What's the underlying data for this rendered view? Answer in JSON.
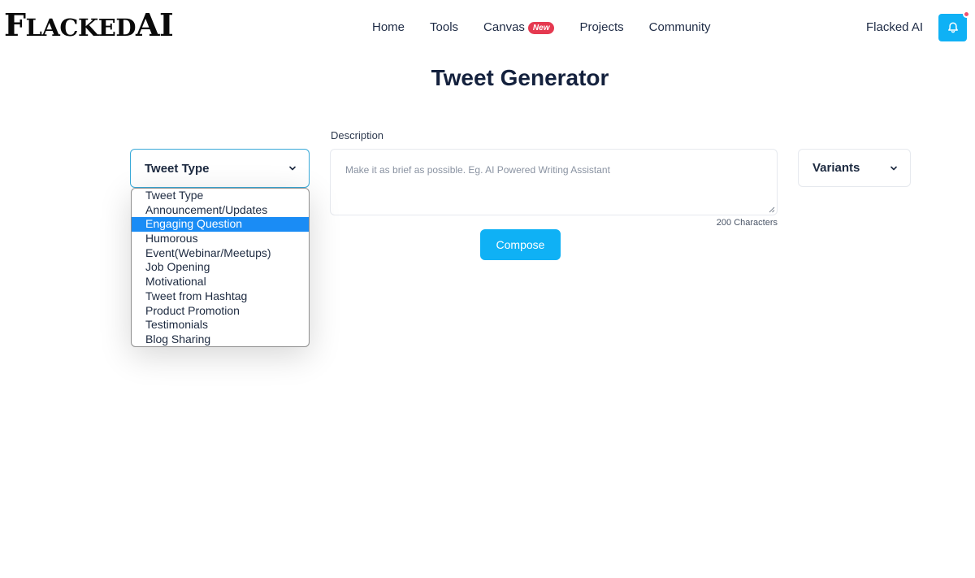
{
  "header": {
    "logo": "FlackedAI",
    "nav": [
      {
        "label": "Home"
      },
      {
        "label": "Tools"
      },
      {
        "label": "Canvas",
        "badge": "New"
      },
      {
        "label": "Projects"
      },
      {
        "label": "Community"
      }
    ],
    "account_name": "Flacked AI",
    "notification_icon": "bell-icon"
  },
  "page_title": "Tweet Generator",
  "form": {
    "tweet_type": {
      "selected": "Tweet Type",
      "options": [
        "Tweet Type",
        "Announcement/Updates",
        "Engaging Question",
        "Humorous",
        "Event(Webinar/Meetups)",
        "Job Opening",
        "Motivational",
        "Tweet from Hashtag",
        "Product Promotion",
        "Testimonials",
        "Blog Sharing"
      ],
      "highlighted": "Engaging Question"
    },
    "description": {
      "label": "Description",
      "placeholder": "Make it as brief as possible. Eg. AI Powered Writing Assistant",
      "char_limit": "200 Characters"
    },
    "variants": {
      "selected": "Variants"
    },
    "compose_label": "Compose"
  },
  "colors": {
    "accent": "#0fb1f5",
    "badge": "#e53950",
    "selected_option": "#1a8cf5"
  }
}
